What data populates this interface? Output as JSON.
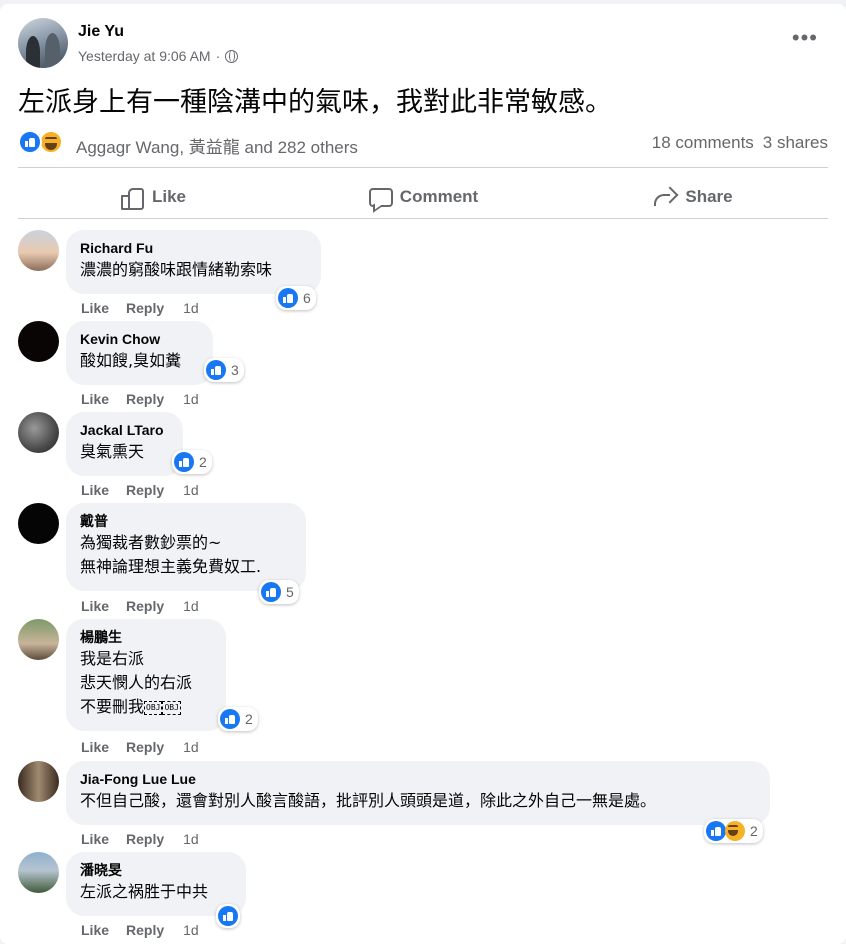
{
  "post": {
    "author": "Jie Yu",
    "timestamp": "Yesterday at 9:06 AM",
    "separator": "·",
    "text": "左派身上有一種陰溝中的氣味，我對此非常敏感。",
    "reactions_names": "Aggagr Wang, 黃益龍 and 282 others",
    "comments_count": "18 comments",
    "shares_count": "3 shares",
    "more_label": "•••"
  },
  "actions": {
    "like": "Like",
    "comment": "Comment",
    "share": "Share"
  },
  "comment_action_labels": {
    "like": "Like",
    "reply": "Reply"
  },
  "comments": [
    {
      "name": "Richard Fu",
      "lines": [
        "濃濃的窮酸味跟情緒勒索味"
      ],
      "time": "1d",
      "reactions": "6"
    },
    {
      "name": "Kevin Chow",
      "lines": [
        "酸如餿,臭如糞"
      ],
      "time": "1d",
      "reactions": "3"
    },
    {
      "name": "Jackal LTaro",
      "lines": [
        "臭氣熏天"
      ],
      "time": "1d",
      "reactions": "2"
    },
    {
      "name": "戴普",
      "lines": [
        "為獨裁者數鈔票的~",
        "無神論理想主義免費奴工."
      ],
      "time": "1d",
      "reactions": "5"
    },
    {
      "name": "楊鵬生",
      "lines": [
        "我是右派",
        "悲天憫人的右派",
        "不要刪我"
      ],
      "obj_marks": [
        "OBJ",
        "OBJ"
      ],
      "time": "1d",
      "reactions": "2"
    },
    {
      "name": "Jia-Fong Lue Lue",
      "lines": [
        "不但自己酸，還會對別人酸言酸語，批評別人頭頭是道，除此之外自己一無是處。"
      ],
      "time": "1d",
      "reactions": "2"
    },
    {
      "name": "潘晓旻",
      "lines": [
        "左派之祸胜于中共"
      ],
      "time": "1d",
      "reactions": ""
    }
  ],
  "colors": {
    "accent": "#1877f2",
    "haha": "#f7b125",
    "secondary_text": "#65676b",
    "bubble": "#f0f2f5"
  }
}
